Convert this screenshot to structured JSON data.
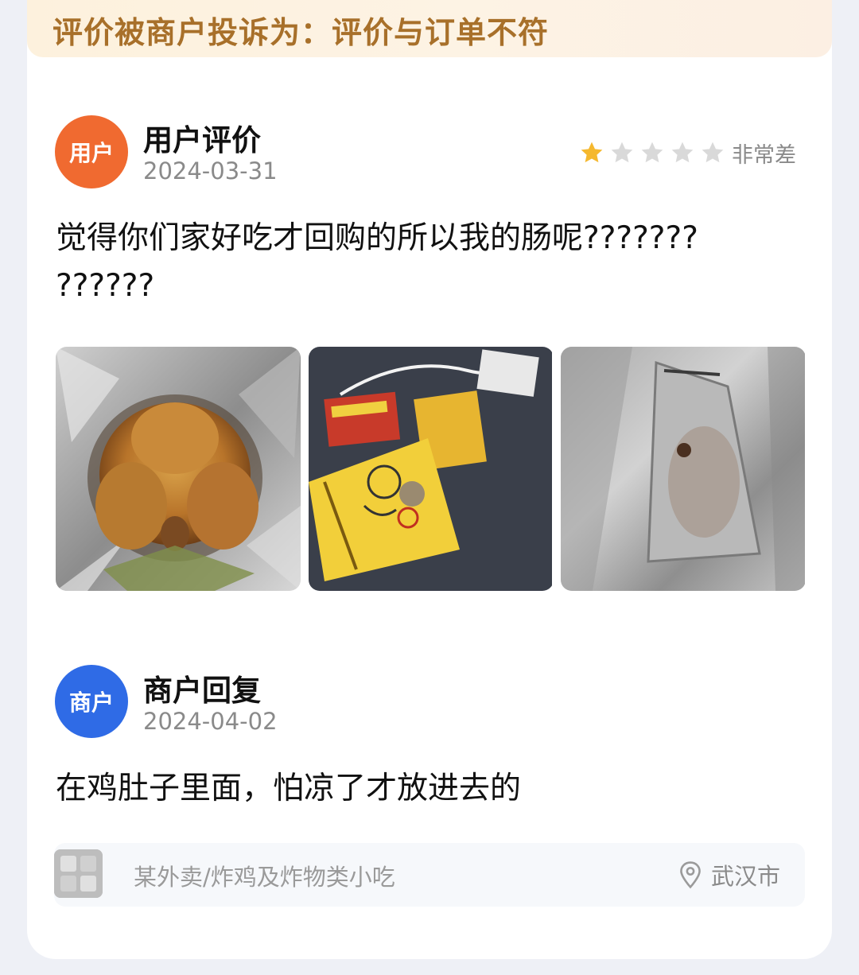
{
  "banner": {
    "text": "评价被商户投诉为：评价与订单不符"
  },
  "review": {
    "avatar_label": "用户",
    "title": "用户评价",
    "date": "2024-03-31",
    "rating": 1,
    "rating_max": 5,
    "rating_text": "非常差",
    "content_line1": "觉得你们家好吃才回购的所以我的肠呢???????",
    "content_line2": "??????",
    "photos": [
      "roast-chicken-in-foil-photo",
      "sauce-packets-photo",
      "empty-foil-bag-photo"
    ]
  },
  "reply": {
    "avatar_label": "商户",
    "title": "商户回复",
    "date": "2024-04-02",
    "content": "在鸡肚子里面，怕凉了才放进去的"
  },
  "footer": {
    "shop_info": "某外卖/炸鸡及炸物类小吃",
    "location": "武汉市"
  },
  "colors": {
    "banner_text": "#a8702a",
    "user_avatar": "#f06a30",
    "merchant_avatar": "#2f6be6",
    "star_active": "#f5b82e",
    "star_inactive": "#d9d9d9"
  }
}
